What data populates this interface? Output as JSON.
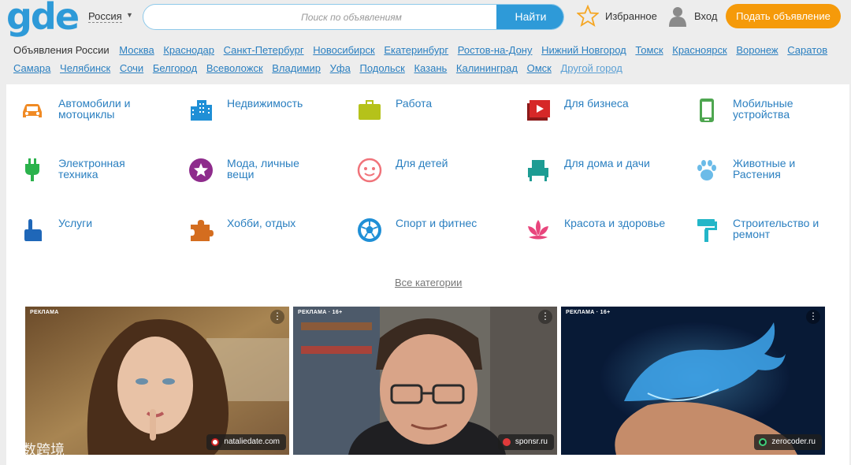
{
  "header": {
    "logo": "gde",
    "region": "Россия",
    "search": {
      "placeholder": "Поиск по объявлениям",
      "button": "Найти"
    },
    "favorites": "Избранное",
    "login": "Вход",
    "post_button": "Подать объявление"
  },
  "cities": {
    "lead": "Объявления России",
    "items": [
      "Москва",
      "Краснодар",
      "Санкт-Петербург",
      "Новосибирск",
      "Екатеринбург",
      "Ростов-на-Дону",
      "Нижний Новгород",
      "Томск",
      "Красноярск",
      "Воронеж",
      "Саратов",
      "Самара",
      "Челябинск",
      "Сочи",
      "Белгород",
      "Всеволожск",
      "Владимир",
      "Уфа",
      "Подольск",
      "Казань",
      "Калининград",
      "Омск"
    ],
    "other": "Другой город"
  },
  "categories": [
    {
      "label": "Автомобили и мотоциклы",
      "icon": "car-icon",
      "color": "#f08a24"
    },
    {
      "label": "Недвижимость",
      "icon": "building-icon",
      "color": "#1f8fd6"
    },
    {
      "label": "Работа",
      "icon": "briefcase-icon",
      "color": "#b5c21a"
    },
    {
      "label": "Для бизнеса",
      "icon": "business-video-icon",
      "color": "#d62828"
    },
    {
      "label": "Мобильные устройства",
      "icon": "smartphone-icon",
      "color": "#4ea650"
    },
    {
      "label": "Электронная техника",
      "icon": "plug-icon",
      "color": "#2bb24c"
    },
    {
      "label": "Мода, личные вещи",
      "icon": "star-badge-icon",
      "color": "#8e2b8c"
    },
    {
      "label": "Для детей",
      "icon": "baby-face-icon",
      "color": "#f0737a"
    },
    {
      "label": "Для дома и дачи",
      "icon": "armchair-icon",
      "color": "#1d9c93"
    },
    {
      "label": "Животные и Растения",
      "icon": "paw-icon",
      "color": "#6bbbe8"
    },
    {
      "label": "Услуги",
      "icon": "pointing-hand-icon",
      "color": "#1f67b8"
    },
    {
      "label": "Хобби, отдых",
      "icon": "puzzle-icon",
      "color": "#d46d1f"
    },
    {
      "label": "Спорт и фитнес",
      "icon": "soccer-ball-icon",
      "color": "#1f8fd6"
    },
    {
      "label": "Красота и здоровье",
      "icon": "lotus-icon",
      "color": "#e8457c"
    },
    {
      "label": "Строительство и ремонт",
      "icon": "paint-roller-icon",
      "color": "#23b6c8"
    }
  ],
  "all_categories": "Все категории",
  "ads": [
    {
      "tag": "РЕКЛАМА",
      "source": "nataliedate.com",
      "menu": "⋮"
    },
    {
      "tag": "РЕКЛАМА · 16+",
      "source": "sponsr.ru",
      "menu": "⋮"
    },
    {
      "tag": "РЕКЛАМА · 16+",
      "source": "zerocoder.ru",
      "menu": "⋮"
    }
  ],
  "watermark": "大数跨境"
}
